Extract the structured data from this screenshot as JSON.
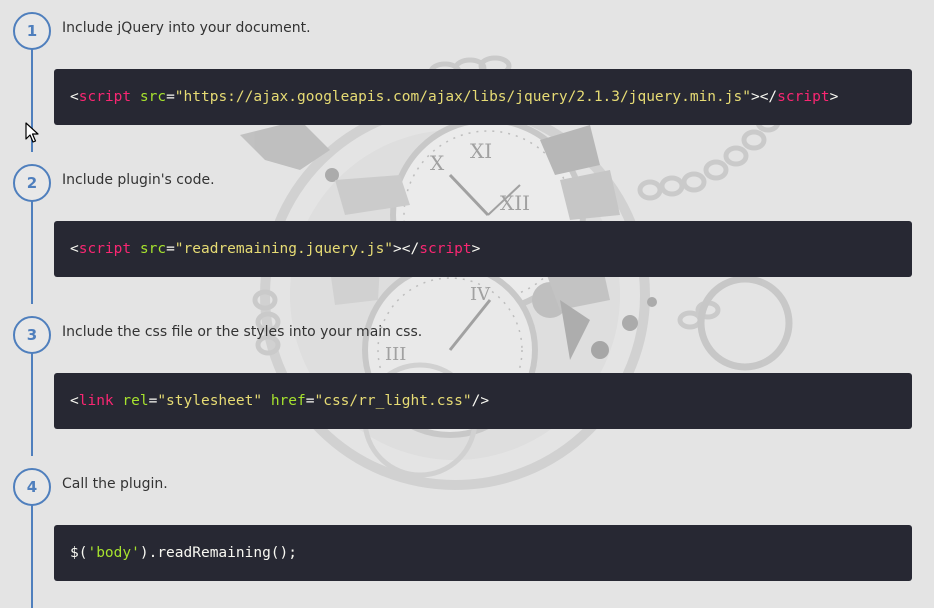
{
  "steps": [
    {
      "number": "1",
      "description": "Include jQuery into your document.",
      "code": [
        {
          "type": "punc",
          "text": "<"
        },
        {
          "type": "tag",
          "text": "script"
        },
        {
          "type": "plain",
          "text": " "
        },
        {
          "type": "attr",
          "text": "src"
        },
        {
          "type": "punc",
          "text": "="
        },
        {
          "type": "str",
          "text": "\"https://ajax.googleapis.com/ajax/libs/jquery/2.1.3/jquery.min.js\""
        },
        {
          "type": "punc",
          "text": "></"
        },
        {
          "type": "tag",
          "text": "script"
        },
        {
          "type": "punc",
          "text": ">"
        }
      ]
    },
    {
      "number": "2",
      "description": "Include plugin's code.",
      "code": [
        {
          "type": "punc",
          "text": "<"
        },
        {
          "type": "tag",
          "text": "script"
        },
        {
          "type": "plain",
          "text": " "
        },
        {
          "type": "attr",
          "text": "src"
        },
        {
          "type": "punc",
          "text": "="
        },
        {
          "type": "str",
          "text": "\"readremaining.jquery.js\""
        },
        {
          "type": "punc",
          "text": "></"
        },
        {
          "type": "tag",
          "text": "script"
        },
        {
          "type": "punc",
          "text": ">"
        }
      ]
    },
    {
      "number": "3",
      "description": "Include the css file or the styles into your main css.",
      "code": [
        {
          "type": "punc",
          "text": "<"
        },
        {
          "type": "tag",
          "text": "link"
        },
        {
          "type": "plain",
          "text": " "
        },
        {
          "type": "attr",
          "text": "rel"
        },
        {
          "type": "punc",
          "text": "="
        },
        {
          "type": "str",
          "text": "\"stylesheet\""
        },
        {
          "type": "plain",
          "text": " "
        },
        {
          "type": "attr",
          "text": "href"
        },
        {
          "type": "punc",
          "text": "="
        },
        {
          "type": "str",
          "text": "\"css/rr_light.css\""
        },
        {
          "type": "punc",
          "text": "/>"
        }
      ]
    },
    {
      "number": "4",
      "description": "Call the plugin.",
      "code": [
        {
          "type": "plain",
          "text": "$("
        },
        {
          "type": "attr",
          "text": "'body'"
        },
        {
          "type": "plain",
          "text": ").readRemaining();"
        }
      ]
    }
  ],
  "icons": {
    "background": "clock-gears-background-icon",
    "cursor": "mouse-pointer-icon"
  },
  "colors": {
    "page_background": "#e4e4e4",
    "accent": "#4f7fbd",
    "code_background": "#272833",
    "code_tag": "#f92672",
    "code_attr": "#a6e22e",
    "code_string": "#e6db74",
    "code_text": "#f8f8f2",
    "description_text": "#333333"
  }
}
